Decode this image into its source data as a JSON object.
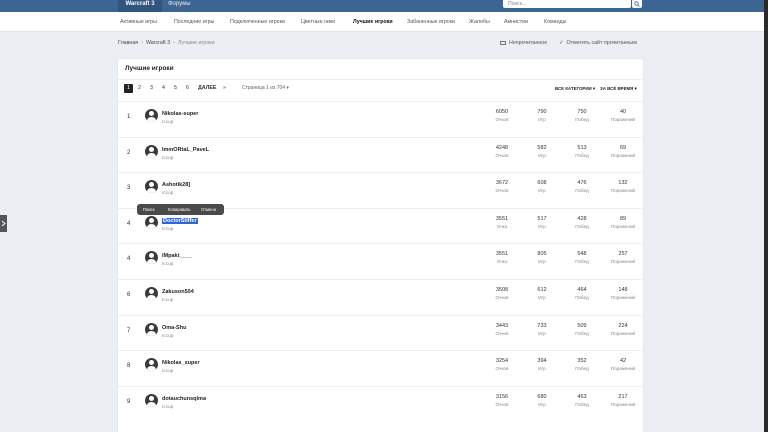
{
  "topbar": {
    "brand": "Warcraft 3",
    "forums": "Форумы",
    "search_placeholder": "Поиск..."
  },
  "subnav": [
    "Активные игры",
    "Последние игры",
    "Подключенные игроки",
    "Цветные ники",
    "Лучшие игроки",
    "Забаненные игроки",
    "Жалобы",
    "Амнистии",
    "Команды"
  ],
  "subnav_active": "Лучшие игроки",
  "breadcrumb": {
    "home": "Главная",
    "section": "Warcraft 3",
    "current": "Лучшие игроки"
  },
  "actions": {
    "unread": "Непрочитанное",
    "mark_read": "Отметить сайт прочитанным"
  },
  "panel": {
    "title": "Лучшие игроки"
  },
  "pagination": {
    "pages": [
      "1",
      "2",
      "3",
      "4",
      "5",
      "6"
    ],
    "active": "1",
    "next": "ДАЛЕЕ",
    "arrow": "»",
    "jump": "Страница 1 из 704 ▾"
  },
  "filters": {
    "category": "ВСЕ КАТЕГОРИИ ▾",
    "period": "ЗА ВСЁ ВРЕМЯ ▾"
  },
  "stat_labels": {
    "points": "Очков",
    "points_short": "Очко",
    "games": "Игр",
    "wins": "Побед",
    "losses": "Поражений"
  },
  "context_menu": {
    "search": "Поиск",
    "copy": "Копировать",
    "share": "Отмена"
  },
  "players": [
    {
      "rank": "1",
      "name": "Nikolas-super",
      "sub": "Iccup",
      "points": "6050",
      "points_label": "Очков",
      "games": "790",
      "wins": "750",
      "losses": "40"
    },
    {
      "rank": "2",
      "name": "ImmORtaL_PaveL",
      "sub": "Iccup",
      "points": "4248",
      "points_label": "Очков",
      "games": "582",
      "wins": "513",
      "losses": "69"
    },
    {
      "rank": "3",
      "name": "Ashotik28]",
      "sub": "Iccup",
      "points": "3672",
      "points_label": "Очков",
      "games": "608",
      "wins": "476",
      "losses": "132"
    },
    {
      "rank": "4",
      "name": "DoctorStiffer",
      "sub": "Iccup",
      "points": "3551",
      "points_label": "Очко",
      "games": "517",
      "wins": "428",
      "losses": "89",
      "selected": true
    },
    {
      "rank": "4",
      "name": "iMpakt____",
      "sub": "Iccup",
      "points": "3551",
      "points_label": "Очко",
      "games": "805",
      "wins": "548",
      "losses": "257"
    },
    {
      "rank": "6",
      "name": "Zakuson504",
      "sub": "Iccup",
      "points": "3508",
      "points_label": "Очков",
      "games": "612",
      "wins": "464",
      "losses": "148"
    },
    {
      "rank": "7",
      "name": "Oma-Shu",
      "sub": "Iccup",
      "points": "3443",
      "points_label": "Очков",
      "games": "733",
      "wins": "509",
      "losses": "224"
    },
    {
      "rank": "8",
      "name": "Nikolas_super",
      "sub": "Iccup",
      "points": "3254",
      "points_label": "Очков",
      "games": "394",
      "wins": "352",
      "losses": "42"
    },
    {
      "rank": "9",
      "name": "dotauchunsqlma",
      "sub": "Iccup",
      "points": "3156",
      "points_label": "Очков",
      "games": "680",
      "wins": "463",
      "losses": "217"
    }
  ]
}
